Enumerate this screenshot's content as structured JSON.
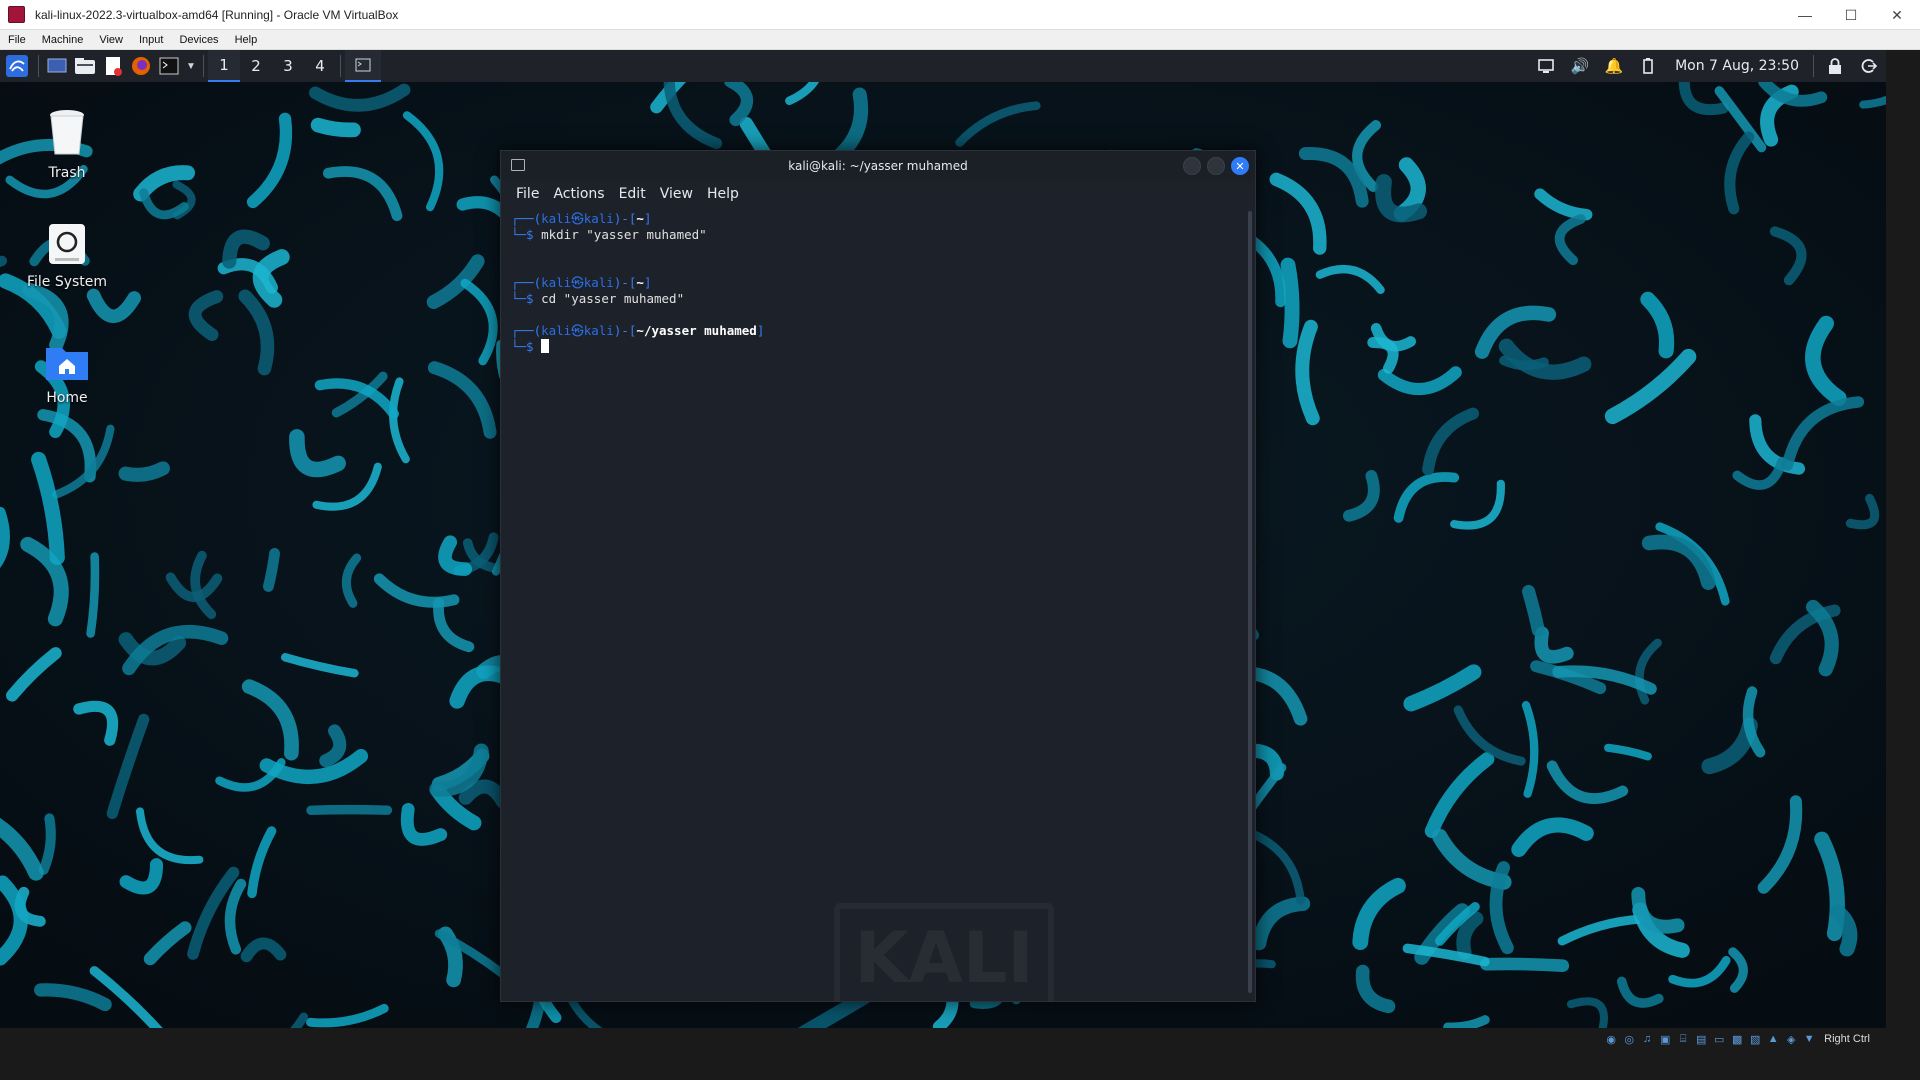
{
  "vbox": {
    "title": "kali-linux-2022.3-virtualbox-amd64 [Running] - Oracle VM VirtualBox",
    "menu": [
      "File",
      "Machine",
      "View",
      "Input",
      "Devices",
      "Help"
    ],
    "window_controls": [
      "minimize",
      "maximize",
      "close"
    ],
    "host_key": "Right Ctrl"
  },
  "panel": {
    "workspaces": [
      "1",
      "2",
      "3",
      "4"
    ],
    "active_workspace": 1,
    "clock": "Mon 7 Aug, 23:50",
    "accent": "#367bf0"
  },
  "desktop": {
    "icons": [
      {
        "label": "Trash",
        "icon": "trash-icon"
      },
      {
        "label": "File System",
        "icon": "drive-icon"
      },
      {
        "label": "Home",
        "icon": "home-folder-icon"
      }
    ]
  },
  "terminal": {
    "title": "kali@kali: ~/yasser muhamed",
    "menu": [
      "File",
      "Actions",
      "Edit",
      "View",
      "Help"
    ],
    "blocks": [
      {
        "user": "kali",
        "host": "kali",
        "dir": "~",
        "command": "mkdir \"yasser muhamed\""
      },
      {
        "user": "kali",
        "host": "kali",
        "dir": "~",
        "command": "cd \"yasser muhamed\""
      },
      {
        "user": "kali",
        "host": "kali",
        "dir": "~/yasser muhamed",
        "command": ""
      }
    ],
    "watermark": "KALI"
  }
}
